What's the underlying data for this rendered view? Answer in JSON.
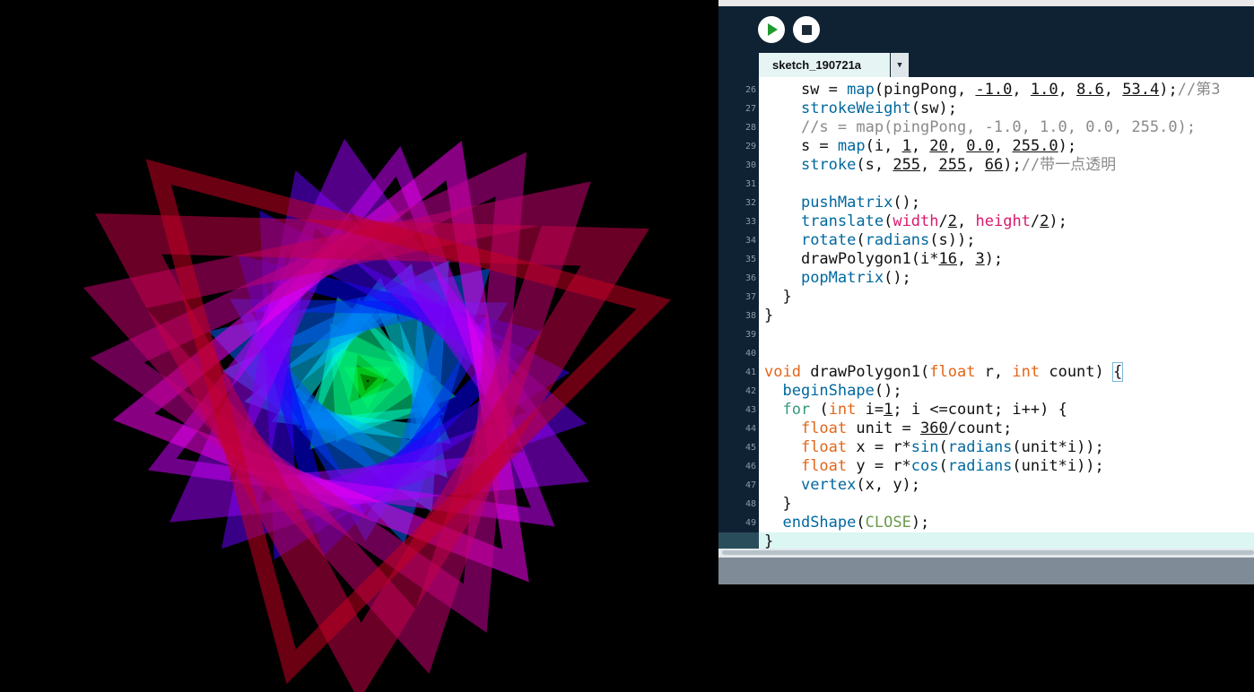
{
  "toolbar": {
    "run_label": "Run",
    "stop_label": "Stop"
  },
  "tab": {
    "name": "sketch_190721a",
    "menu_glyph": "▼"
  },
  "editor": {
    "lines": [
      {
        "n": "26",
        "html": "    sw = <span class=\"fn\">map</span>(pingPong, <span class=\"u\">-1.0</span>, <span class=\"u\">1.0</span>, <span class=\"u\">8.6</span>, <span class=\"u\">53.4</span>);<span class=\"cm\">//第3</span>"
      },
      {
        "n": "27",
        "html": "    <span class=\"fn\">strokeWeight</span>(sw);"
      },
      {
        "n": "28",
        "html": "    <span class=\"cm\">//s = map(pingPong, -1.0, 1.0, 0.0, 255.0);</span>"
      },
      {
        "n": "29",
        "html": "    s = <span class=\"fn\">map</span>(i, <span class=\"u\">1</span>, <span class=\"u\">20</span>, <span class=\"u\">0.0</span>, <span class=\"u\">255.0</span>);"
      },
      {
        "n": "30",
        "html": "    <span class=\"fn\">stroke</span>(s, <span class=\"u\">255</span>, <span class=\"u\">255</span>, <span class=\"u\">66</span>);<span class=\"cm\">//带一点透明</span>"
      },
      {
        "n": "31",
        "html": ""
      },
      {
        "n": "32",
        "html": "    <span class=\"fn\">pushMatrix</span>();"
      },
      {
        "n": "33",
        "html": "    <span class=\"fn\">translate</span>(<span class=\"cn\">width</span>/<span class=\"u\">2</span>, <span class=\"cn\">height</span>/<span class=\"u\">2</span>);"
      },
      {
        "n": "34",
        "html": "    <span class=\"fn\">rotate</span>(<span class=\"fn\">radians</span>(s));"
      },
      {
        "n": "35",
        "html": "    drawPolygon1(i*<span class=\"u\">16</span>, <span class=\"u\">3</span>);"
      },
      {
        "n": "36",
        "html": "    <span class=\"fn\">popMatrix</span>();"
      },
      {
        "n": "37",
        "html": "  }"
      },
      {
        "n": "38",
        "html": "}"
      },
      {
        "n": "39",
        "html": ""
      },
      {
        "n": "40",
        "html": ""
      },
      {
        "n": "41",
        "html": "<span class=\"kw\">void</span> drawPolygon1(<span class=\"kw\">float</span> r, <span class=\"kw\">int</span> count) <span class=\"cur\">{</span>"
      },
      {
        "n": "42",
        "html": "  <span class=\"fn\">beginShape</span>();"
      },
      {
        "n": "43",
        "html": "  <span class=\"kb\">for</span> (<span class=\"kw\">int</span> i=<span class=\"u\">1</span>; i &lt;=count; i++) {"
      },
      {
        "n": "44",
        "html": "    <span class=\"kw\">float</span> unit = <span class=\"u\">360</span>/count;"
      },
      {
        "n": "45",
        "html": "    <span class=\"kw\">float</span> x = r*<span class=\"fn\">sin</span>(<span class=\"fn\">radians</span>(unit*i));"
      },
      {
        "n": "46",
        "html": "    <span class=\"kw\">float</span> y = r*<span class=\"fn\">cos</span>(<span class=\"fn\">radians</span>(unit*i));"
      },
      {
        "n": "47",
        "html": "    <span class=\"fn\">vertex</span>(x, y);"
      },
      {
        "n": "48",
        "html": "  }"
      },
      {
        "n": "49",
        "html": "  <span class=\"fn\">endShape</span>(<span class=\"const\">CLOSE</span>);"
      },
      {
        "n": "50",
        "html": "}"
      }
    ]
  },
  "colors": {
    "editor_bg": "#0f2234",
    "tab_bg": "#e6f5f4",
    "status_bar": "#7f8c97"
  }
}
